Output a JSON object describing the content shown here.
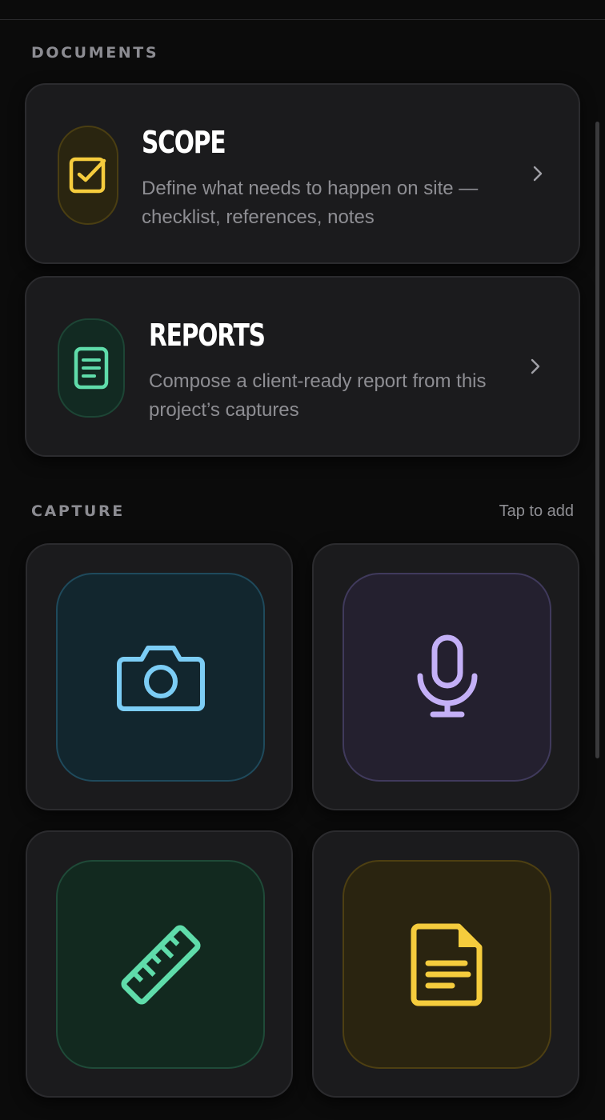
{
  "documents": {
    "section_label": "DOCUMENTS",
    "cards": [
      {
        "title": "SCOPE",
        "description": "Define what needs to happen on site — checklist, references, notes",
        "icon": "checkbox-icon",
        "accent": "#f5cc3d"
      },
      {
        "title": "REPORTS",
        "description": "Compose a client-ready report from this project’s captures",
        "icon": "document-lines-icon",
        "accent": "#5fdcaa"
      }
    ]
  },
  "capture": {
    "section_label": "CAPTURE",
    "hint": "Tap to add",
    "tiles": [
      {
        "icon": "camera-icon",
        "accent": "#7ccdf5"
      },
      {
        "icon": "microphone-icon",
        "accent": "#c4b0f7"
      },
      {
        "icon": "ruler-icon",
        "accent": "#5fdcaa"
      },
      {
        "icon": "note-document-icon",
        "accent": "#f5cc3d"
      }
    ]
  },
  "colors": {
    "background": "#0b0b0b",
    "card": "#1b1b1d",
    "muted_text": "#8e8e93"
  }
}
